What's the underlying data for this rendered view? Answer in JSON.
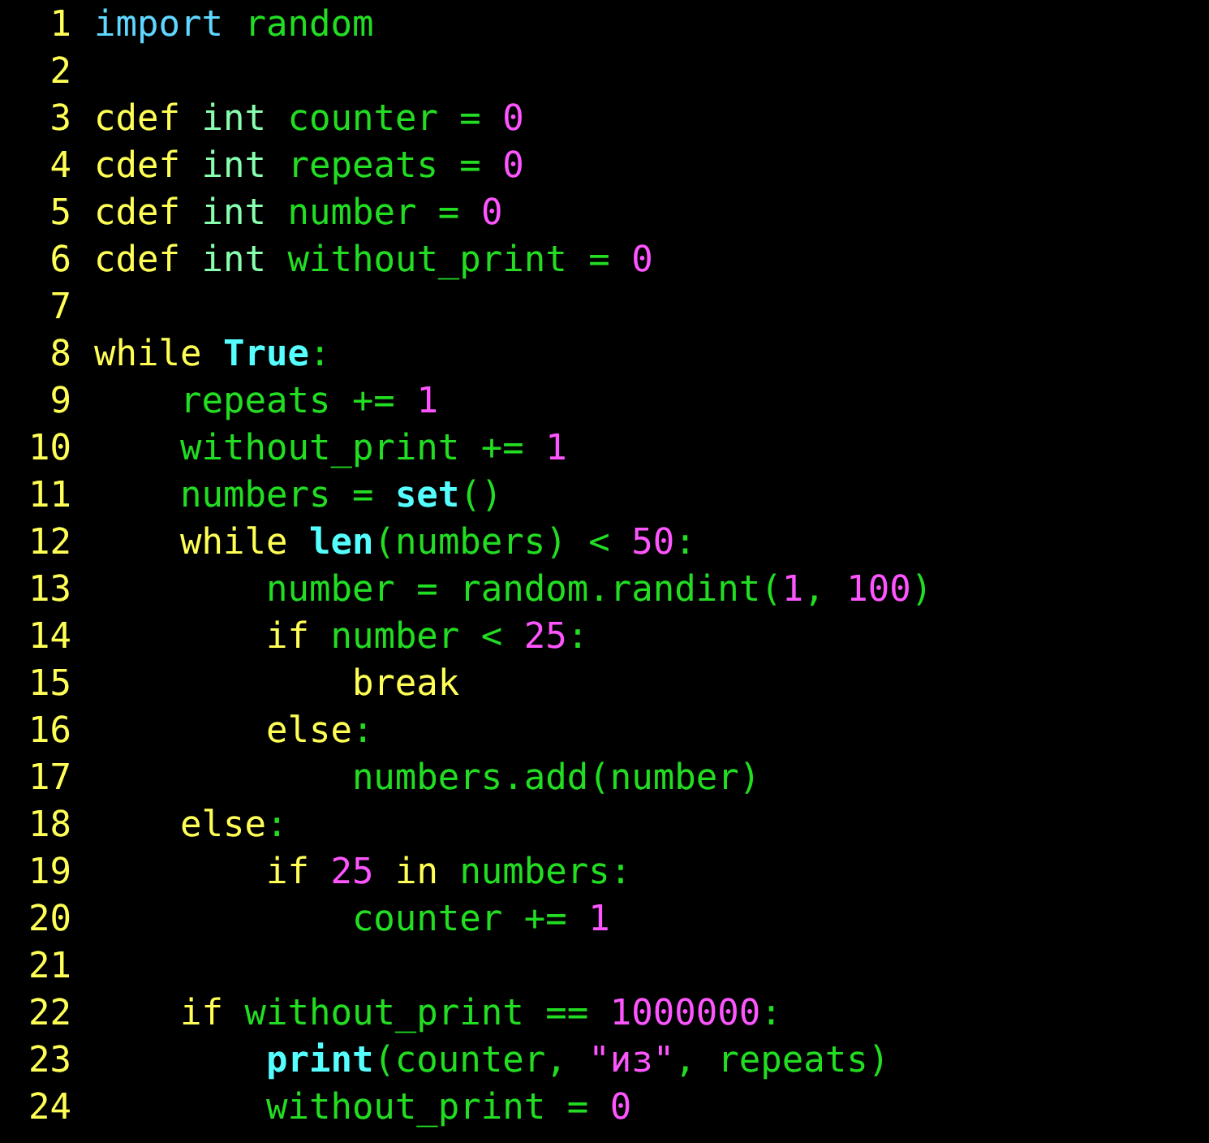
{
  "lines": [
    {
      "number": "1",
      "tokens": [
        {
          "text": "import ",
          "kind": "include"
        },
        {
          "text": "random",
          "kind": "ident"
        }
      ]
    },
    {
      "number": "2"
    },
    {
      "number": "3",
      "tokens": [
        {
          "text": "cdef ",
          "kind": "keyword"
        },
        {
          "text": "int ",
          "kind": "type"
        },
        {
          "text": "counter = ",
          "kind": "ident"
        },
        {
          "text": "0",
          "kind": "number"
        }
      ]
    },
    {
      "number": "4",
      "tokens": [
        {
          "text": "cdef ",
          "kind": "keyword"
        },
        {
          "text": "int ",
          "kind": "type"
        },
        {
          "text": "repeats = ",
          "kind": "ident"
        },
        {
          "text": "0",
          "kind": "number"
        }
      ]
    },
    {
      "number": "5",
      "tokens": [
        {
          "text": "cdef ",
          "kind": "keyword"
        },
        {
          "text": "int ",
          "kind": "type"
        },
        {
          "text": "number = ",
          "kind": "ident"
        },
        {
          "text": "0",
          "kind": "number"
        }
      ]
    },
    {
      "number": "6",
      "tokens": [
        {
          "text": "cdef ",
          "kind": "keyword"
        },
        {
          "text": "int ",
          "kind": "type"
        },
        {
          "text": "without_print = ",
          "kind": "ident"
        },
        {
          "text": "0",
          "kind": "number"
        }
      ]
    },
    {
      "number": "7"
    },
    {
      "number": "8",
      "tokens": [
        {
          "text": "while ",
          "kind": "keyword"
        },
        {
          "text": "True",
          "kind": "builtin"
        },
        {
          "text": ":",
          "kind": "ident"
        }
      ]
    },
    {
      "number": "9",
      "tokens": [
        {
          "text": "    repeats += ",
          "kind": "ident"
        },
        {
          "text": "1",
          "kind": "number"
        }
      ]
    },
    {
      "number": "10",
      "tokens": [
        {
          "text": "    without_print += ",
          "kind": "ident"
        },
        {
          "text": "1",
          "kind": "number"
        }
      ]
    },
    {
      "number": "11",
      "tokens": [
        {
          "text": "    numbers = ",
          "kind": "ident"
        },
        {
          "text": "set",
          "kind": "builtin"
        },
        {
          "text": "()",
          "kind": "ident"
        }
      ]
    },
    {
      "number": "12",
      "tokens": [
        {
          "text": "    while ",
          "kind": "keyword"
        },
        {
          "text": "len",
          "kind": "builtin"
        },
        {
          "text": "(numbers) < ",
          "kind": "ident"
        },
        {
          "text": "50",
          "kind": "number"
        },
        {
          "text": ":",
          "kind": "ident"
        }
      ]
    },
    {
      "number": "13",
      "tokens": [
        {
          "text": "        number = random.randint(",
          "kind": "ident"
        },
        {
          "text": "1",
          "kind": "number"
        },
        {
          "text": ", ",
          "kind": "ident"
        },
        {
          "text": "100",
          "kind": "number"
        },
        {
          "text": ")",
          "kind": "ident"
        }
      ]
    },
    {
      "number": "14",
      "tokens": [
        {
          "text": "        if ",
          "kind": "keyword"
        },
        {
          "text": "number < ",
          "kind": "ident"
        },
        {
          "text": "25",
          "kind": "number"
        },
        {
          "text": ":",
          "kind": "ident"
        }
      ]
    },
    {
      "number": "15",
      "tokens": [
        {
          "text": "            break",
          "kind": "keyword"
        }
      ]
    },
    {
      "number": "16",
      "tokens": [
        {
          "text": "        else",
          "kind": "keyword"
        },
        {
          "text": ":",
          "kind": "ident"
        }
      ]
    },
    {
      "number": "17",
      "tokens": [
        {
          "text": "            numbers.add(number)",
          "kind": "ident"
        }
      ]
    },
    {
      "number": "18",
      "tokens": [
        {
          "text": "    else",
          "kind": "keyword"
        },
        {
          "text": ":",
          "kind": "ident"
        }
      ]
    },
    {
      "number": "19",
      "tokens": [
        {
          "text": "        if ",
          "kind": "keyword"
        },
        {
          "text": "25",
          "kind": "number"
        },
        {
          "text": " in ",
          "kind": "keyword"
        },
        {
          "text": "numbers:",
          "kind": "ident"
        }
      ]
    },
    {
      "number": "20",
      "tokens": [
        {
          "text": "            counter += ",
          "kind": "ident"
        },
        {
          "text": "1",
          "kind": "number"
        }
      ]
    },
    {
      "number": "21"
    },
    {
      "number": "22",
      "tokens": [
        {
          "text": "    if ",
          "kind": "keyword"
        },
        {
          "text": "without_print == ",
          "kind": "ident"
        },
        {
          "text": "1000000",
          "kind": "number"
        },
        {
          "text": ":",
          "kind": "ident"
        }
      ]
    },
    {
      "number": "23",
      "tokens": [
        {
          "text": "        print",
          "kind": "builtin"
        },
        {
          "text": "(counter, ",
          "kind": "ident"
        },
        {
          "text": "\"из\"",
          "kind": "string"
        },
        {
          "text": ", repeats)",
          "kind": "ident"
        }
      ]
    },
    {
      "number": "24",
      "tokens": [
        {
          "text": "        without_print = ",
          "kind": "ident"
        },
        {
          "text": "0",
          "kind": "number"
        }
      ]
    }
  ]
}
